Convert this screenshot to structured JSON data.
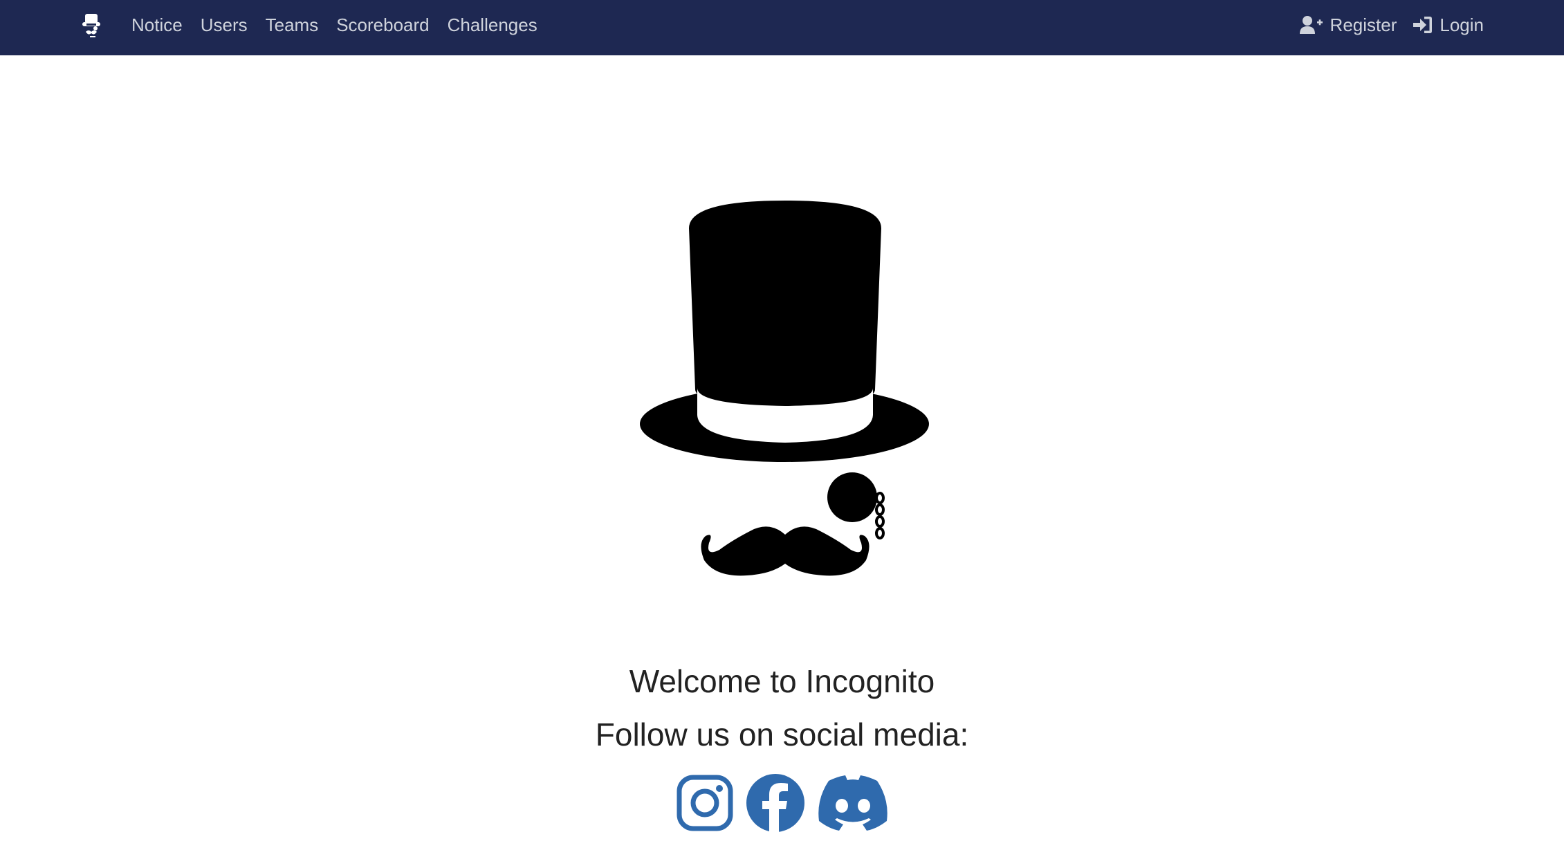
{
  "nav": {
    "brand_icon": "incognito-logo-icon",
    "links": [
      "Notice",
      "Users",
      "Teams",
      "Scoreboard",
      "Challenges"
    ],
    "register_label": "Register",
    "register_icon": "user-plus-icon",
    "login_label": "Login",
    "login_icon": "sign-in-icon"
  },
  "hero": {
    "logo_icon": "top-hat-monocle-mustache-icon"
  },
  "main": {
    "welcome_text": "Welcome to Incognito",
    "follow_text": "Follow us on social media:"
  },
  "social": {
    "icons": [
      "instagram-icon",
      "facebook-icon",
      "discord-icon"
    ]
  },
  "colors": {
    "navbar_bg": "#1e2852",
    "nav_text": "#cfd3dc",
    "social_blue": "#2f6aad",
    "text": "#222222"
  }
}
